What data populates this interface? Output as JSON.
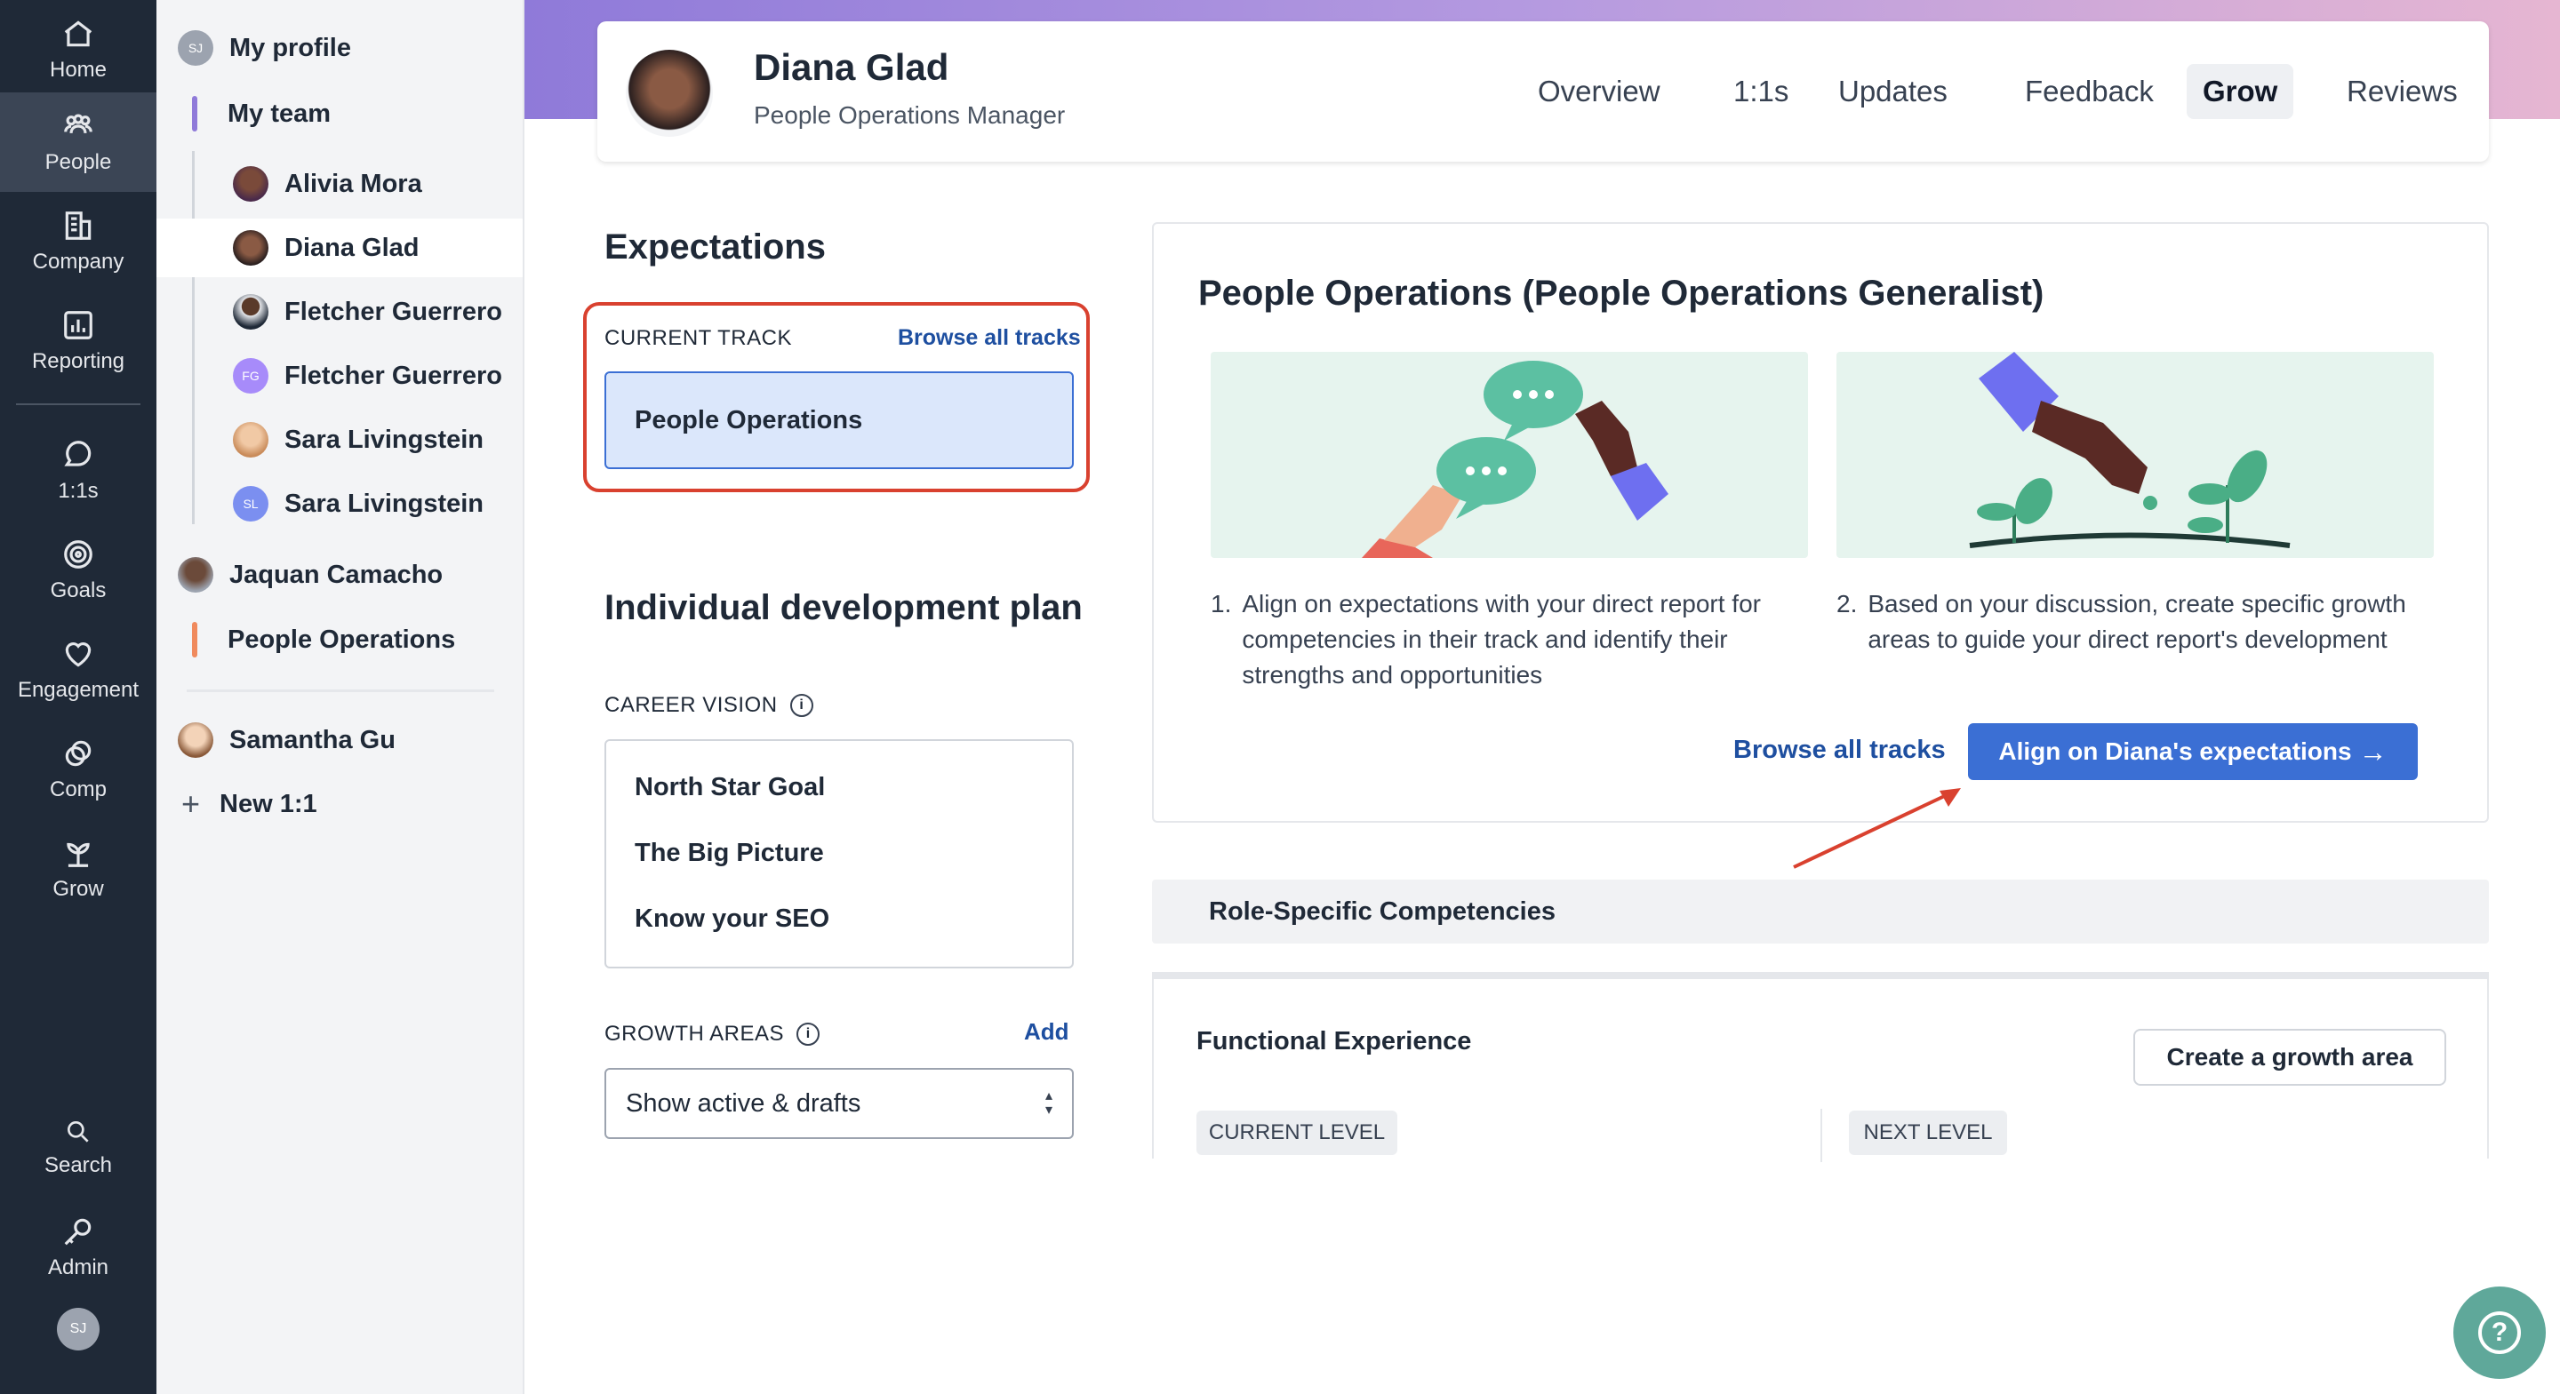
{
  "rail": {
    "items": [
      {
        "label": "Home",
        "icon": "home-icon"
      },
      {
        "label": "People",
        "icon": "people-icon"
      },
      {
        "label": "Company",
        "icon": "company-icon"
      },
      {
        "label": "Reporting",
        "icon": "reporting-icon"
      },
      {
        "label": "1:1s",
        "icon": "chat-icon"
      },
      {
        "label": "Goals",
        "icon": "target-icon"
      },
      {
        "label": "Engagement",
        "icon": "heart-icon"
      },
      {
        "label": "Comp",
        "icon": "coins-icon"
      },
      {
        "label": "Grow",
        "icon": "plant-icon"
      },
      {
        "label": "Search",
        "icon": "search-icon"
      },
      {
        "label": "Admin",
        "icon": "key-icon"
      }
    ],
    "user_initials": "SJ"
  },
  "sidebar": {
    "my_profile": {
      "label": "My profile",
      "initials": "SJ"
    },
    "my_team": "My team",
    "team": [
      {
        "name": "Alivia Mora"
      },
      {
        "name": "Diana Glad"
      },
      {
        "name": "Fletcher Guerrero"
      },
      {
        "name": "Fletcher Guerrero",
        "initials": "FG"
      },
      {
        "name": "Sara Livingstein"
      },
      {
        "name": "Sara Livingstein",
        "initials": "SL"
      }
    ],
    "manager": "Jaquan Camacho",
    "department": "People Operations",
    "other": "Samantha Gu",
    "new_one_on_one": "New 1:1"
  },
  "header": {
    "name": "Diana Glad",
    "title": "People Operations Manager",
    "tabs": [
      "Overview",
      "1:1s",
      "Updates",
      "Feedback",
      "Grow",
      "Reviews"
    ],
    "active_tab": "Grow"
  },
  "expectations": {
    "heading": "Expectations",
    "current_track_label": "CURRENT TRACK",
    "browse_link": "Browse all tracks",
    "current_track": "People Operations"
  },
  "idp": {
    "heading": "Individual development plan",
    "career_vision_label": "CAREER VISION",
    "career_vision_items": [
      "North Star Goal",
      "The Big Picture",
      "Know your SEO"
    ],
    "growth_areas_label": "GROWTH AREAS",
    "add_link": "Add",
    "filter_value": "Show active & drafts"
  },
  "track_card": {
    "title": "People Operations (People Operations Generalist)",
    "step1": "Align on expectations with your direct report for competencies in their track and identify their strengths and opportunities",
    "step2": "Based on your discussion, create specific growth areas to guide your direct report's development",
    "step1_num": "1.",
    "step2_num": "2.",
    "browse_link": "Browse all tracks",
    "align_button": "Align on Diana's expectations"
  },
  "competencies": {
    "section_label": "Role-Specific Competencies",
    "item_title": "Functional Experience",
    "create_button": "Create a growth area",
    "current_level": "CURRENT LEVEL",
    "next_level": "NEXT LEVEL"
  },
  "colors": {
    "accent": "#3b6fd4",
    "highlight_border": "#d9412f",
    "rail_bg": "#1f2937",
    "help_bg": "#5fa89a"
  }
}
